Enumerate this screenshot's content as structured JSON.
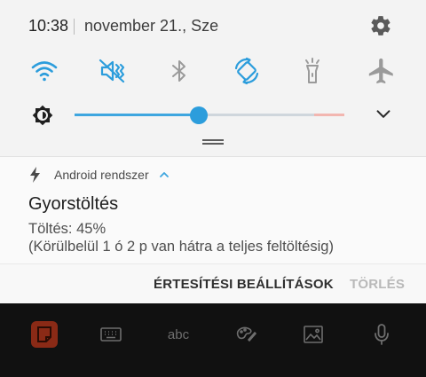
{
  "status_bar": {
    "time": "10:38",
    "date": "november 21., Sze"
  },
  "quick_settings": {
    "toggles": [
      {
        "icon": "wifi-icon",
        "state": "on"
      },
      {
        "icon": "sound-mute-icon",
        "state": "on"
      },
      {
        "icon": "bluetooth-icon",
        "state": "off"
      },
      {
        "icon": "auto-rotate-icon",
        "state": "on"
      },
      {
        "icon": "flashlight-icon",
        "state": "off"
      },
      {
        "icon": "airplane-mode-icon",
        "state": "off"
      }
    ],
    "brightness_level": 0.46
  },
  "notification": {
    "app_name": "Android rendszer",
    "title": "Gyorstöltés",
    "line1": "Töltés: 45%",
    "line2": "(Körülbelül 1 ó 2 p van hátra a teljes feltöltésig)",
    "settings_button": "ÉRTESÍTÉSI BEÁLLÍTÁSOK",
    "clear_button": "TÖRLÉS"
  },
  "keyboard_toolbar": {
    "abc_label": "abc",
    "icons": [
      "sticker-icon",
      "keyboard-icon",
      "handwriting-abc-icon",
      "palette-icon",
      "image-icon",
      "microphone-icon"
    ]
  },
  "colors": {
    "accent": "#2c9ddc",
    "inactive_icon": "#9a9a9a",
    "panel_bg": "#f3f3f3"
  }
}
